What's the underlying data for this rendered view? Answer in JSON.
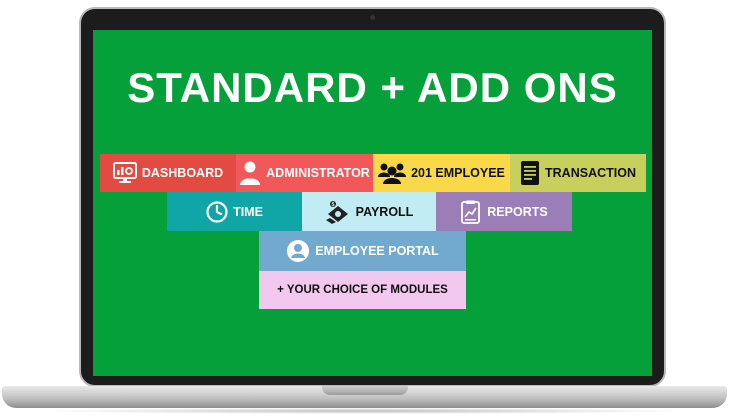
{
  "headline": "STANDARD + ADD ONS",
  "modules": {
    "dashboard": {
      "label": "DASHBOARD",
      "icon": "dashboard-icon",
      "color": "#e24b42"
    },
    "administrator": {
      "label": "ADMINISTRATOR",
      "icon": "admin-user-icon",
      "color": "#f1585a"
    },
    "employee_201": {
      "label": "201 EMPLOYEE",
      "icon": "employee-group-icon",
      "color": "#f9d84a"
    },
    "transaction": {
      "label": "TRANSACTION",
      "icon": "document-icon",
      "color": "#c9cf5d"
    },
    "time": {
      "label": "TIME",
      "icon": "clock-icon",
      "color": "#10a6a7"
    },
    "payroll": {
      "label": "PAYROLL",
      "icon": "payroll-money-icon",
      "color": "#c2ecf4"
    },
    "reports": {
      "label": "REPORTS",
      "icon": "report-chart-icon",
      "color": "#9b7eb8"
    },
    "employee_portal": {
      "label": "EMPLOYEE PORTAL",
      "icon": "user-circle-icon",
      "color": "#72a9cf"
    },
    "choice": {
      "label": "+ YOUR CHOICE OF MODULES",
      "color": "#f2c8ee"
    }
  },
  "screen_color": "#06a03b"
}
